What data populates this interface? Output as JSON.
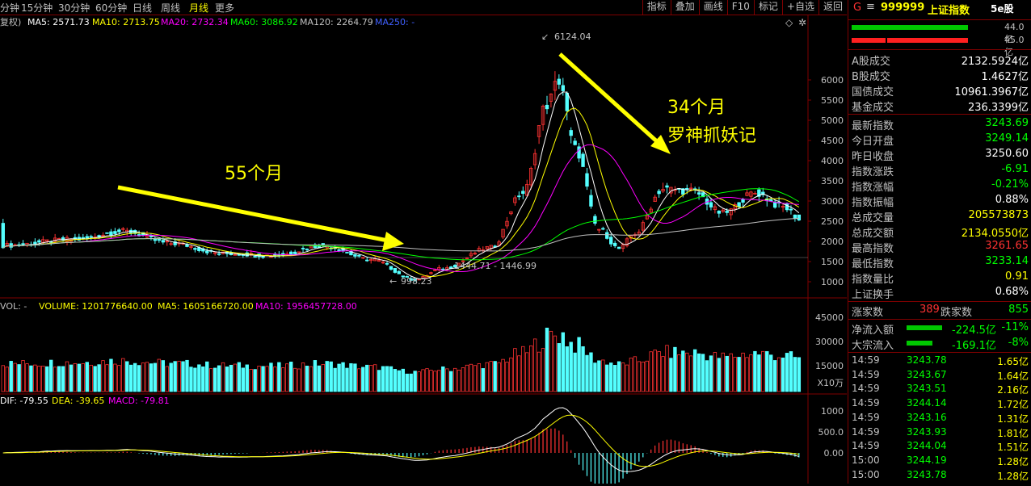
{
  "toolbar": {
    "tabs": [
      "分钟",
      "15分钟",
      "30分钟",
      "60分钟",
      "日线",
      "周线",
      "月线",
      "更多"
    ],
    "active_tab": "月线",
    "buttons": [
      "指标",
      "叠加",
      "画线",
      "F10",
      "标记",
      "+自选",
      "返回"
    ]
  },
  "ma_legend": {
    "prefix": "复权)",
    "ma5": "MA5: 2571.73",
    "ma10": "MA10: 2713.75",
    "ma20": "MA20: 2732.34",
    "ma60": "MA60: 3086.92",
    "ma120": "MA120: 2264.79",
    "ma250": "MA250: -"
  },
  "annotations": {
    "left_text": "55个月",
    "right_text_1": "34个月",
    "right_text_2": "罗神抓妖记",
    "peak_label": "6124.04",
    "low_label": "998.23",
    "mid_label": "1444.71 - 1446.99"
  },
  "price_axis": [
    "6000",
    "5500",
    "5000",
    "4500",
    "4000",
    "3500",
    "3000",
    "2500",
    "2000",
    "1500",
    "1000"
  ],
  "volume_legend": {
    "prefix": "VOL: -",
    "volume": "VOLUME: 1201776640.00",
    "ma5": "MA5: 1605166720.00",
    "ma10": "MA10: 1956457728.00"
  },
  "volume_axis": [
    "45000",
    "30000",
    "15000"
  ],
  "volume_unit": "X10万",
  "macd_legend": {
    "dif": "DIF: -79.55",
    "dea": "DEA: -39.65",
    "macd": "MACD: -79.81"
  },
  "macd_axis": [
    "1000",
    "500.0",
    "0.00"
  ],
  "colors": {
    "up": "#ff3232",
    "down": "#54ffff",
    "ma5": "#ffffff",
    "ma10": "#ffff00",
    "ma20": "#ff00ff",
    "ma60": "#00ff00",
    "annotation": "#ffff00",
    "grid": "#800000"
  },
  "panel": {
    "code": "999999",
    "name": "上证指数",
    "buy_amount": "44.0亿",
    "sell_amount": "45.0亿",
    "stats": [
      {
        "label": "A股成交",
        "value": "2132.5924亿",
        "color": "#ffffff"
      },
      {
        "label": "B股成交",
        "value": "1.4627亿",
        "color": "#ffffff"
      },
      {
        "label": "国债成交",
        "value": "10961.3967亿",
        "color": "#ffffff"
      },
      {
        "label": "基金成交",
        "value": "236.3399亿",
        "color": "#ffffff"
      }
    ],
    "quote": [
      {
        "label": "最新指数",
        "value": "3243.69",
        "color": "#00ff00"
      },
      {
        "label": "今日开盘",
        "value": "3249.14",
        "color": "#00ff00"
      },
      {
        "label": "昨日收盘",
        "value": "3250.60",
        "color": "#ffffff"
      },
      {
        "label": "指数涨跌",
        "value": "-6.91",
        "color": "#00ff00"
      },
      {
        "label": "指数涨幅",
        "value": "-0.21%",
        "color": "#00ff00"
      },
      {
        "label": "指数振幅",
        "value": "0.88%",
        "color": "#ffffff"
      },
      {
        "label": "总成交量",
        "value": "205573873",
        "color": "#ffff00"
      },
      {
        "label": "总成交额",
        "value": "2134.0550亿",
        "color": "#ffff00"
      },
      {
        "label": "最高指数",
        "value": "3261.65",
        "color": "#ff3232"
      },
      {
        "label": "最低指数",
        "value": "3233.14",
        "color": "#00ff00"
      },
      {
        "label": "指数量比",
        "value": "0.91",
        "color": "#ffff00"
      },
      {
        "label": "上证换手",
        "value": "0.68%",
        "color": "#ffffff"
      }
    ],
    "up_label": "涨家数",
    "up_count": "389",
    "down_label": "跌家数",
    "down_count": "855",
    "flows": [
      {
        "label": "净流入额",
        "value": "-224.5亿",
        "pct": "-11%"
      },
      {
        "label": "大宗流入",
        "value": "-169.1亿",
        "pct": "-8%"
      }
    ],
    "ticks": [
      {
        "time": "14:59",
        "price": "3243.78",
        "amount": "1.65亿"
      },
      {
        "time": "14:59",
        "price": "3243.67",
        "amount": "1.64亿"
      },
      {
        "time": "14:59",
        "price": "3243.51",
        "amount": "2.16亿"
      },
      {
        "time": "14:59",
        "price": "3244.14",
        "amount": "1.72亿"
      },
      {
        "time": "14:59",
        "price": "3243.16",
        "amount": "1.31亿"
      },
      {
        "time": "14:59",
        "price": "3243.93",
        "amount": "1.81亿"
      },
      {
        "time": "14:59",
        "price": "3244.04",
        "amount": "1.51亿"
      },
      {
        "time": "15:00",
        "price": "3244.19",
        "amount": "1.28亿"
      },
      {
        "time": "15:00",
        "price": "3243.78",
        "amount": "1.28亿"
      }
    ]
  }
}
